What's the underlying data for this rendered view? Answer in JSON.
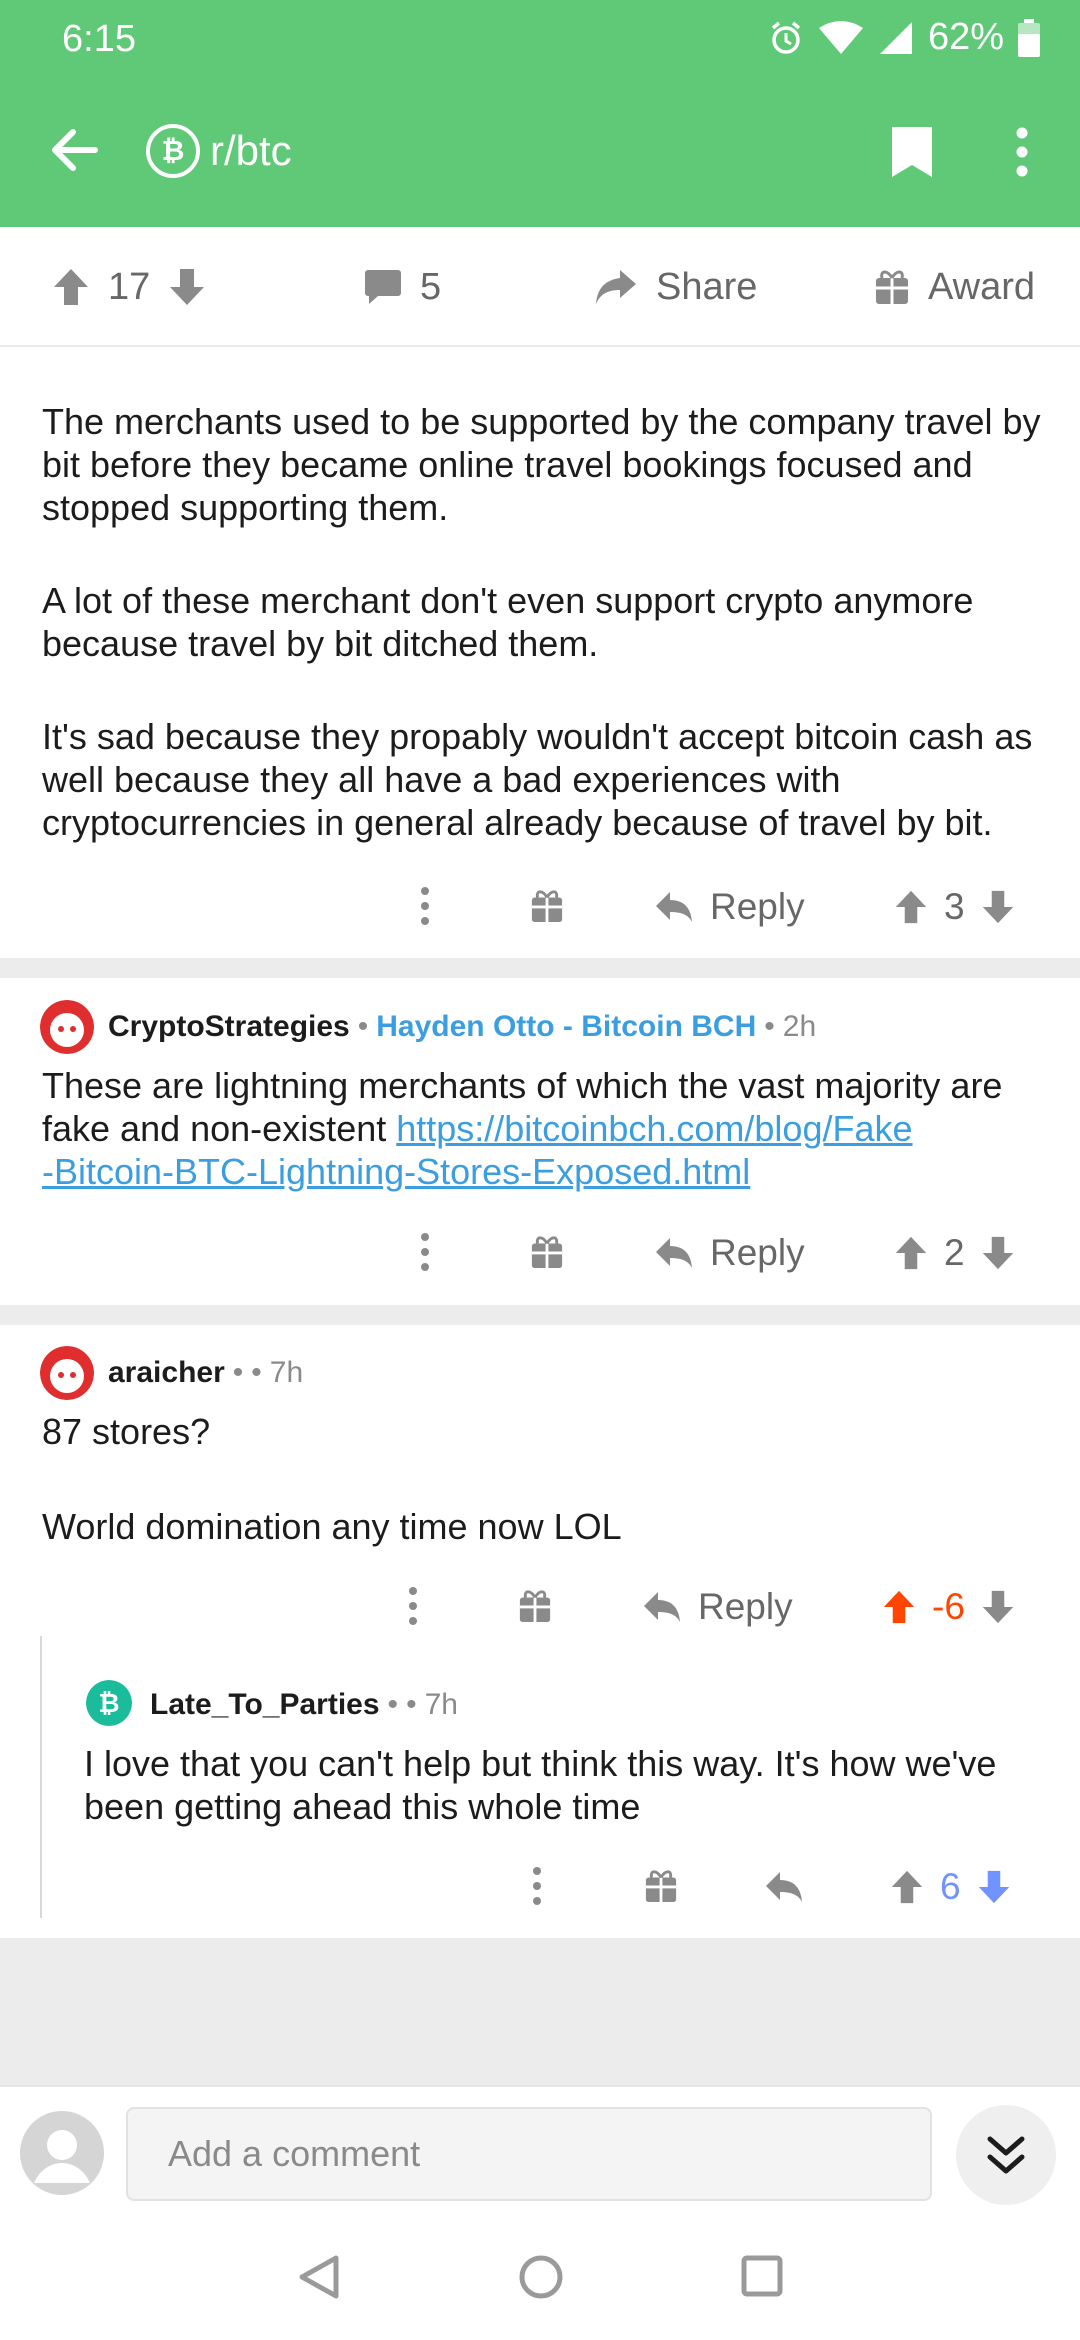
{
  "status_bar": {
    "time": "6:15",
    "battery": "62%"
  },
  "header": {
    "subreddit": "r/btc",
    "subreddit_icon": "bitcoin-icon",
    "accent": "#60c978"
  },
  "post_actions": {
    "score": "17",
    "comments": "5",
    "share_label": "Share",
    "award_label": "Award"
  },
  "comments": [
    {
      "paragraphs": [
        "The merchants used to be supported by the company travel by bit before they became online travel bookings focused and stopped supporting them.",
        "A lot of these merchant don't even support crypto anymore because travel by bit ditched them.",
        "It's sad because they propably wouldn't accept bitcoin cash as well because they all have a bad experiences with cryptocurrencies in general already because of travel by bit."
      ],
      "reply_label": "Reply",
      "score": "3"
    },
    {
      "author": "CryptoStrategies",
      "flair": "Hayden Otto - Bitcoin BCH",
      "age": "2h",
      "text": "These are lightning merchants of which the vast majority are fake and non-existent ",
      "link": "https://bitcoinbch.com/blog/Fake-Bitcoin-BTC-Lightning-Stores-Exposed.html",
      "link_line1": "https://bitcoinbch.com/blog/Fake",
      "link_line2": "-Bitcoin-BTC-Lightning-Stores-Exposed.html",
      "reply_label": "Reply",
      "score": "2"
    },
    {
      "author": "araicher",
      "age": "7h",
      "line1": "87 stores?",
      "line2": "World domination any time now LOL",
      "reply_label": "Reply",
      "score": "-6",
      "score_color": "#ff4500"
    },
    {
      "author": "Late_To_Parties",
      "age": "7h",
      "text": "I love that you can't help but think this way. It's how we've been getting ahead this whole time",
      "score": "6",
      "score_color": "#7193ff"
    }
  ],
  "comment_bar": {
    "placeholder": "Add a comment"
  }
}
